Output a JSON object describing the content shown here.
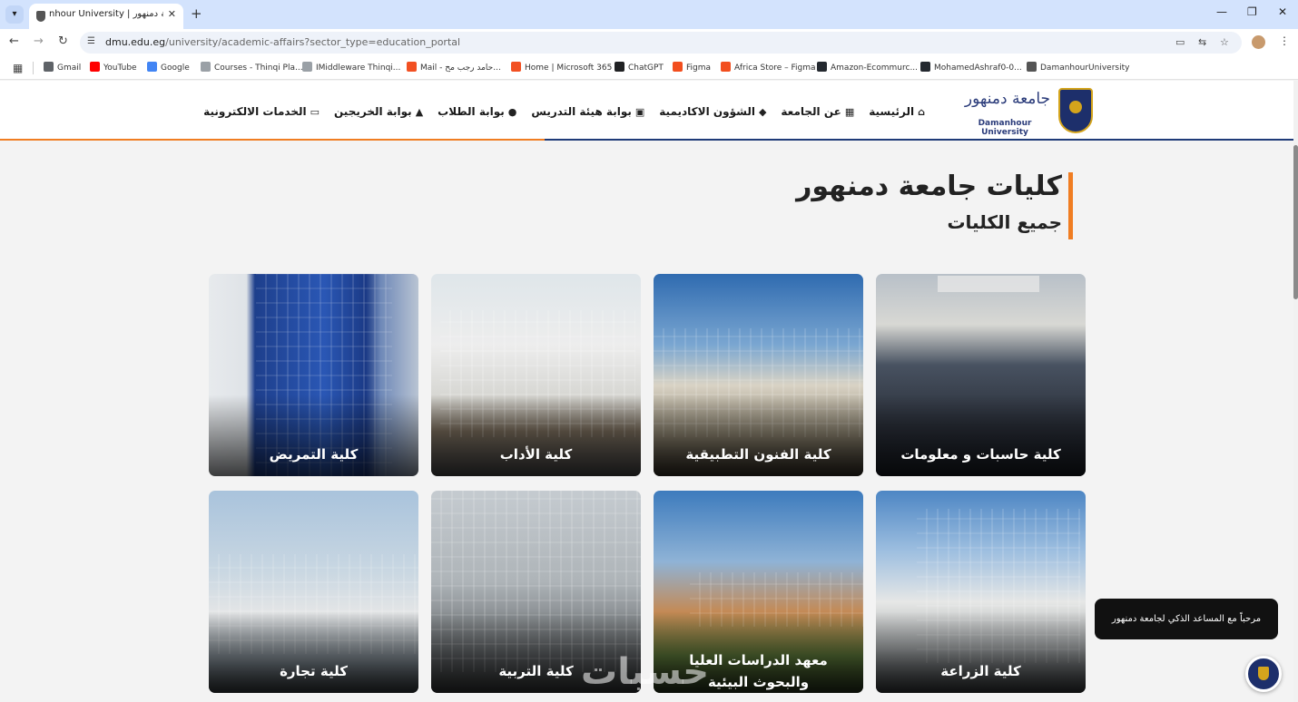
{
  "browser": {
    "tab_title": "nhour University | جامعة دمنهور",
    "url_host": "dmu.edu.eg",
    "url_path": "/university/academic-affairs?sector_type=education_portal",
    "bookmarks": [
      {
        "label": "Gmail",
        "color": "#5f6368"
      },
      {
        "label": "YouTube",
        "color": "#ff0000"
      },
      {
        "label": "Google",
        "color": "#4285f4"
      },
      {
        "label": "Courses - Thinqi Pla...",
        "color": "#9aa0a6"
      },
      {
        "label": "IMiddleware Thinqi...",
        "color": "#9aa0a6"
      },
      {
        "label": "Mail - حامد رجب مح...",
        "color": "#f25022"
      },
      {
        "label": "Home | Microsoft 365",
        "color": "#f25022"
      },
      {
        "label": "ChatGPT",
        "color": "#202123"
      },
      {
        "label": "Figma",
        "color": "#f24e1e"
      },
      {
        "label": "Africa Store – Figma",
        "color": "#f24e1e"
      },
      {
        "label": "Amazon-Ecommurc...",
        "color": "#24292f"
      },
      {
        "label": "MohamedAshraf0-0...",
        "color": "#24292f"
      },
      {
        "label": "DamanhourUniversity",
        "color": "#555555"
      }
    ]
  },
  "site": {
    "logo_ar": "جامعة دمنهور",
    "logo_en": "Damanhour University",
    "nav": [
      {
        "label": "الرئيسية",
        "icon": "home-icon",
        "glyph": "⌂"
      },
      {
        "label": "عن الجامعة",
        "icon": "university-icon",
        "glyph": "▦"
      },
      {
        "label": "الشؤون الاكاديمية",
        "icon": "graduation-cap-icon",
        "glyph": "◆"
      },
      {
        "label": "بوابة هيئة التدريس",
        "icon": "teacher-icon",
        "glyph": "▣"
      },
      {
        "label": "بوابة الطلاب",
        "icon": "students-icon",
        "glyph": "●"
      },
      {
        "label": "بوابة الخريجين",
        "icon": "graduate-icon",
        "glyph": "▲"
      },
      {
        "label": "الخدمات الالكترونية",
        "icon": "monitor-icon",
        "glyph": "▭"
      }
    ],
    "accent_color": "#f07d22",
    "brand_color": "#1f3b78"
  },
  "page": {
    "title": "كليات جامعة دمنهور",
    "subtitle": "جميع الكليات"
  },
  "faculties": [
    {
      "name": "كلية التمريض"
    },
    {
      "name": "كلية الأداب"
    },
    {
      "name": "كلية الفنون التطبيقية"
    },
    {
      "name": "كلية حاسبات و معلومات"
    },
    {
      "name": "كلية تجارة"
    },
    {
      "name": "كلية التربية"
    },
    {
      "name": "معهد الدراسات العليا والبحوث البيئية"
    },
    {
      "name": "كلية الزراعة"
    }
  ],
  "chat": {
    "welcome": "مرحباً مع المساعد الذكي لجامعة دمنهور"
  },
  "watermark": "حسبات"
}
